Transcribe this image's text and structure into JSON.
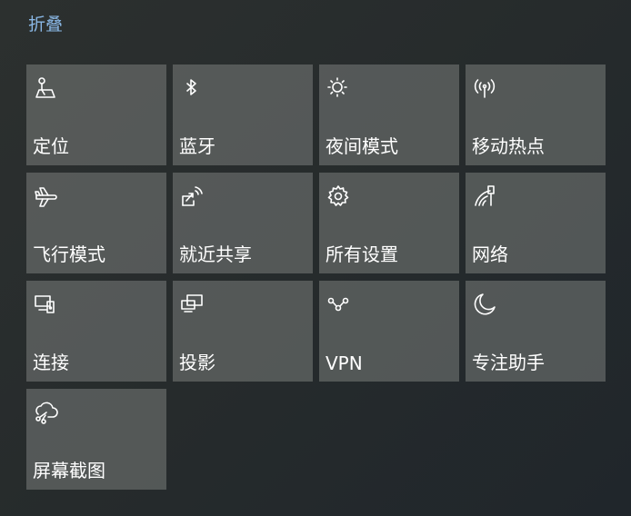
{
  "header": {
    "collapse_label": "折叠"
  },
  "tiles": [
    {
      "label": "定位",
      "icon": "location-icon"
    },
    {
      "label": "蓝牙",
      "icon": "bluetooth-icon"
    },
    {
      "label": "夜间模式",
      "icon": "brightness-icon"
    },
    {
      "label": "移动热点",
      "icon": "hotspot-icon"
    },
    {
      "label": "飞行模式",
      "icon": "airplane-icon"
    },
    {
      "label": "就近共享",
      "icon": "nearby-share-icon"
    },
    {
      "label": "所有设置",
      "icon": "gear-icon"
    },
    {
      "label": "网络",
      "icon": "network-icon"
    },
    {
      "label": "连接",
      "icon": "connect-icon"
    },
    {
      "label": "投影",
      "icon": "project-icon"
    },
    {
      "label": "VPN",
      "icon": "vpn-icon"
    },
    {
      "label": "专注助手",
      "icon": "moon-icon"
    },
    {
      "label": "屏幕截图",
      "icon": "screen-snip-icon"
    }
  ],
  "colors": {
    "accent": "#8ab8e6",
    "tile_background": "#5f6362",
    "text": "#ffffff"
  }
}
